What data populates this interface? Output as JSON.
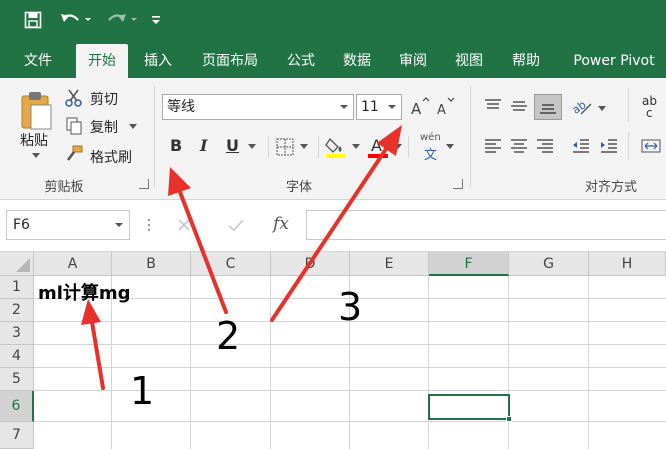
{
  "quick_access": {
    "icons": [
      "save-icon",
      "undo-icon",
      "redo-icon",
      "customize-icon"
    ]
  },
  "tabs": [
    {
      "label": "文件"
    },
    {
      "label": "开始"
    },
    {
      "label": "插入"
    },
    {
      "label": "页面布局"
    },
    {
      "label": "公式"
    },
    {
      "label": "数据"
    },
    {
      "label": "审阅"
    },
    {
      "label": "视图"
    },
    {
      "label": "帮助"
    },
    {
      "label": "Power Pivot"
    }
  ],
  "ribbon": {
    "clipboard": {
      "paste_label": "粘贴",
      "cut_label": "剪切",
      "copy_label": "复制",
      "format_painter_label": "格式刷",
      "group_label": "剪贴板"
    },
    "font": {
      "font_name": "等线",
      "font_size": "11",
      "bold": "B",
      "italic": "I",
      "underline": "U",
      "phonetic_top": "wén",
      "phonetic_bottom": "文",
      "group_label": "字体",
      "fill_color": "#ffff00",
      "font_color": "#ff0000"
    },
    "alignment": {
      "wrap_top": "ab",
      "wrap_bottom": "c",
      "group_label": "对齐方式"
    }
  },
  "formula_bar": {
    "name_box": "F6",
    "fx_label": "fx",
    "value": ""
  },
  "sheet": {
    "columns": [
      "A",
      "B",
      "C",
      "D",
      "E",
      "F",
      "G",
      "H"
    ],
    "rows": [
      "1",
      "2",
      "3",
      "4",
      "5",
      "6",
      "7"
    ],
    "selected_column": "F",
    "selected_row": "6",
    "cells": {
      "A1": "ml计算mg"
    }
  },
  "annotations": {
    "labels": [
      "1",
      "2",
      "3"
    ],
    "arrow_color": "#e8312a"
  },
  "colors": {
    "brand": "#217346"
  }
}
